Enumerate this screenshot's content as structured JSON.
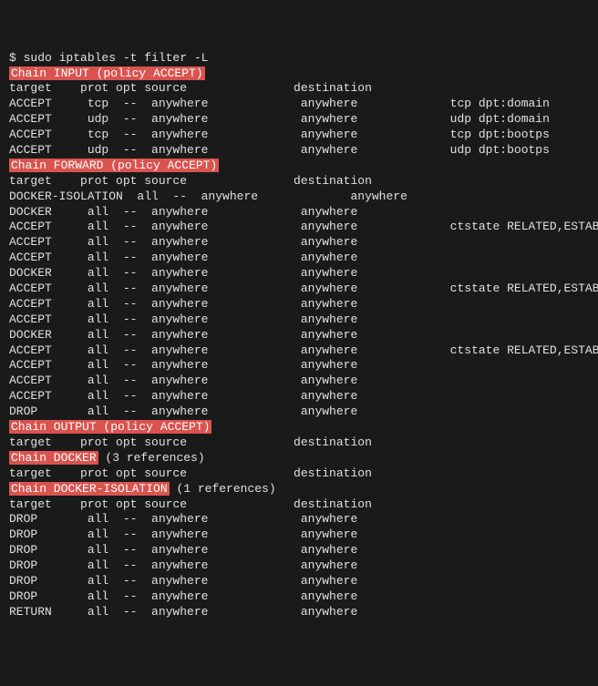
{
  "command": "$ sudo iptables -t filter -L",
  "header_cols": "target    prot opt source               destination",
  "chains": {
    "input": {
      "title": "Chain INPUT (policy ACCEPT)",
      "rows": [
        "ACCEPT     tcp  --  anywhere             anywhere             tcp dpt:domain",
        "ACCEPT     udp  --  anywhere             anywhere             udp dpt:domain",
        "ACCEPT     tcp  --  anywhere             anywhere             tcp dpt:bootps",
        "ACCEPT     udp  --  anywhere             anywhere             udp dpt:bootps"
      ]
    },
    "forward": {
      "title": "Chain FORWARD (policy ACCEPT)",
      "rows": [
        "DOCKER-ISOLATION  all  --  anywhere             anywhere",
        "DOCKER     all  --  anywhere             anywhere",
        "ACCEPT     all  --  anywhere             anywhere             ctstate RELATED,ESTABLISHED",
        "ACCEPT     all  --  anywhere             anywhere",
        "ACCEPT     all  --  anywhere             anywhere",
        "DOCKER     all  --  anywhere             anywhere",
        "ACCEPT     all  --  anywhere             anywhere             ctstate RELATED,ESTABLISHED",
        "ACCEPT     all  --  anywhere             anywhere",
        "ACCEPT     all  --  anywhere             anywhere",
        "DOCKER     all  --  anywhere             anywhere",
        "ACCEPT     all  --  anywhere             anywhere             ctstate RELATED,ESTABLISHED",
        "ACCEPT     all  --  anywhere             anywhere",
        "ACCEPT     all  --  anywhere             anywhere",
        "ACCEPT     all  --  anywhere             anywhere",
        "DROP       all  --  anywhere             anywhere"
      ]
    },
    "output": {
      "title": "Chain OUTPUT (policy ACCEPT)",
      "rows": []
    },
    "docker": {
      "title": "Chain DOCKER",
      "ref": " (3 references)",
      "rows": []
    },
    "docker_isolation": {
      "title": "Chain DOCKER-ISOLATION",
      "ref": " (1 references)",
      "rows": [
        "DROP       all  --  anywhere             anywhere",
        "DROP       all  --  anywhere             anywhere",
        "DROP       all  --  anywhere             anywhere",
        "DROP       all  --  anywhere             anywhere",
        "DROP       all  --  anywhere             anywhere",
        "DROP       all  --  anywhere             anywhere",
        "RETURN     all  --  anywhere             anywhere"
      ]
    }
  }
}
